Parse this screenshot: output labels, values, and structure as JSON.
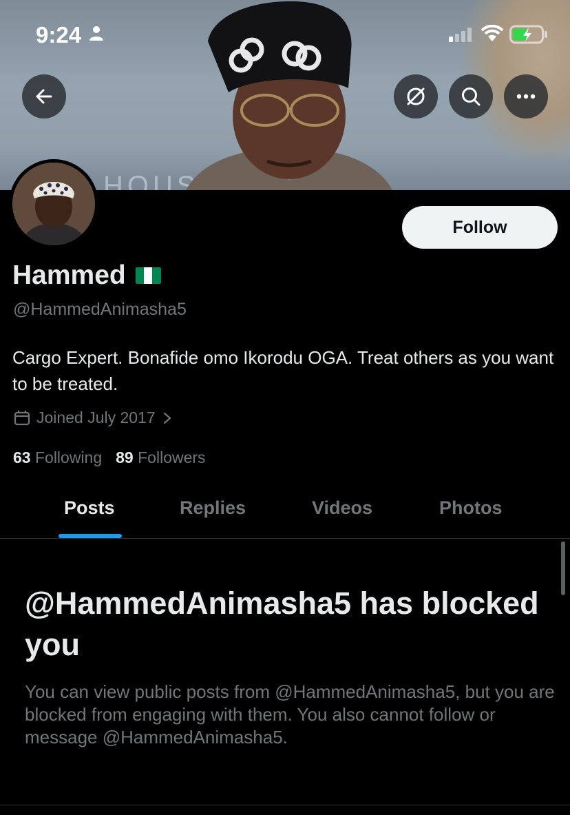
{
  "status_bar": {
    "time": "9:24"
  },
  "banner": {
    "wall_text": "HOUSE"
  },
  "profile": {
    "name": "Hammed",
    "handle": "@HammedAnimasha5",
    "bio": "Cargo Expert. Bonafide omo Ikorodu OGA. Treat others as you want to be treated.",
    "joined": "Joined July 2017",
    "following_count": "63",
    "following_label": "Following",
    "followers_count": "89",
    "followers_label": "Followers",
    "flag_colors": [
      "#008751",
      "#ffffff",
      "#008751"
    ]
  },
  "actions": {
    "follow_label": "Follow"
  },
  "icons": {
    "back": "arrow-left-icon",
    "translate": "translate-icon",
    "search": "search-icon",
    "more": "more-icon",
    "calendar": "calendar-icon",
    "chevron": "chevron-right-icon"
  },
  "tabs": [
    {
      "label": "Posts",
      "active": true
    },
    {
      "label": "Replies",
      "active": false
    },
    {
      "label": "Videos",
      "active": false
    },
    {
      "label": "Photos",
      "active": false
    }
  ],
  "blocked": {
    "title": "@HammedAnimasha5 has blocked you",
    "description": "You can view public posts from @HammedAnimasha5, but you are blocked from engaging with them. You also cannot follow or message @HammedAnimasha5."
  },
  "colors": {
    "accent": "#1d9bf0",
    "background": "#000000",
    "text_primary": "#e7e9ea",
    "text_secondary": "#71767b",
    "battery_green": "#32d74b"
  }
}
